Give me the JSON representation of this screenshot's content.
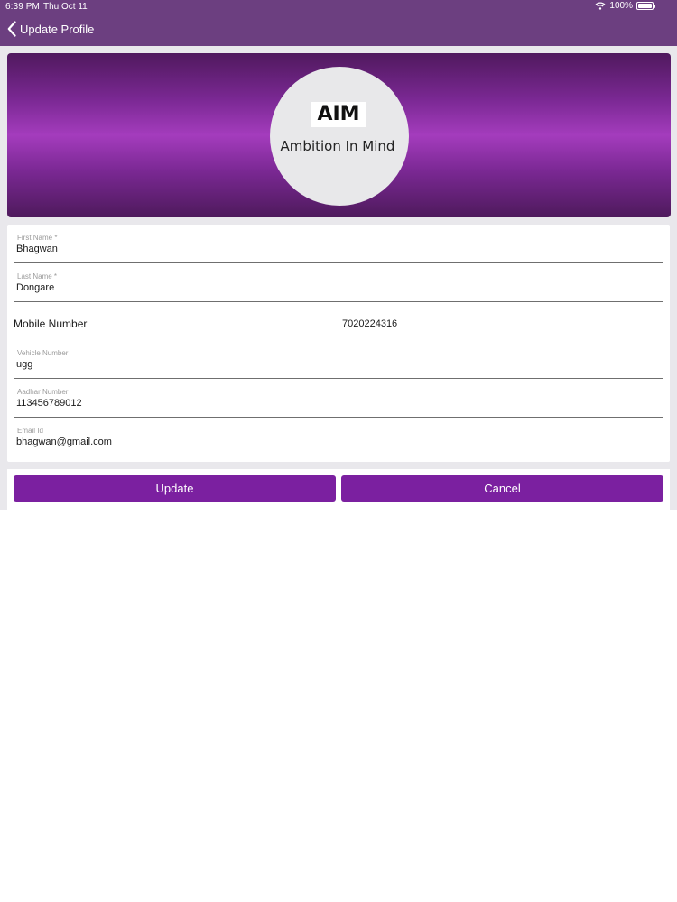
{
  "status_bar": {
    "time": "6:39 PM",
    "date": "Thu Oct 11",
    "battery": "100%"
  },
  "nav": {
    "title": "Update Profile",
    "back_icon": "chevron-left-icon"
  },
  "logo": {
    "abbr": "AIM",
    "tagline": "Ambition In Mind"
  },
  "form": {
    "first_name": {
      "label": "First Name *",
      "value": "Bhagwan"
    },
    "last_name": {
      "label": "Last Name *",
      "value": "Dongare"
    },
    "mobile": {
      "label": "Mobile Number",
      "value": "7020224316"
    },
    "vehicle": {
      "label": "Vehicle Number",
      "value": "ugg"
    },
    "aadhar": {
      "label": "Aadhar Number",
      "value": "113456789012"
    },
    "email": {
      "label": "Email Id",
      "value": "bhagwan@gmail.com"
    }
  },
  "buttons": {
    "update": "Update",
    "cancel": "Cancel"
  },
  "colors": {
    "nav_bar": "#6c3f80",
    "accent": "#7b20a0",
    "banner": "#a43cbd",
    "background": "#e9e8ec"
  }
}
